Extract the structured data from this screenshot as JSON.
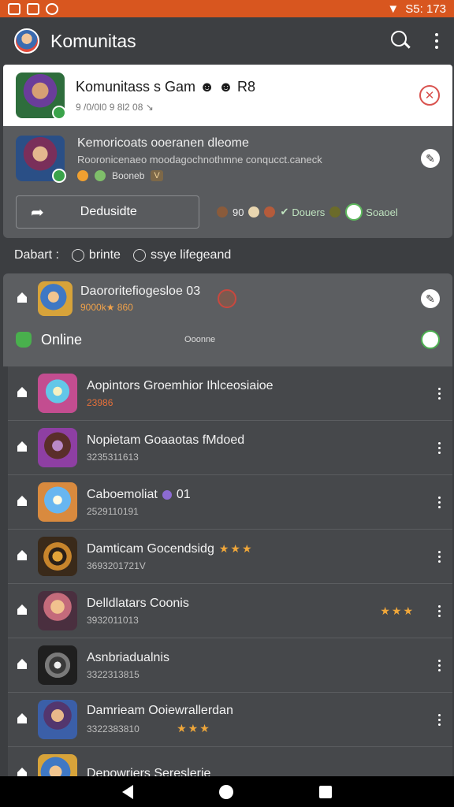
{
  "status_bar": {
    "right_text": "S5: 173"
  },
  "app_bar": {
    "title": "Komunitas"
  },
  "featured": {
    "title": "Komunitass s Gam",
    "emoji": "☻ ☻ R8",
    "meta": "9 /0/0l0 9 8l2 08 ↘"
  },
  "details": {
    "title": "Kemoricoats ooeranen dleome",
    "description": "Rooronicenaeo moodagochnothmne conqucct.caneck",
    "tag_label": "Booneb",
    "tag_box": "V",
    "share_label": "Dedusidte",
    "chip_count": "90",
    "chip_green_label": "Douers",
    "chip_pill_label": "Soaoel"
  },
  "filter": {
    "label": "Dabart :",
    "chip1": "brinte",
    "chip2": "ssye lifegeand"
  },
  "section": {
    "title": "Daororitefiogesloe 03",
    "subtitle": "9000k★ 860",
    "online_label": "Online",
    "online_count": "Ooonne"
  },
  "games": [
    {
      "title": "Aopintors Groemhior Ihlceosiaioe",
      "subtitle": "23986",
      "orange": true,
      "extra": "",
      "stars": ""
    },
    {
      "title": "Nopietam Goaaotas fMdoed",
      "subtitle": "3235311613",
      "orange": false,
      "extra": "",
      "stars": ""
    },
    {
      "title": "Caboemoliat",
      "subtitle": "2529110191",
      "orange": false,
      "extra": "01",
      "stars": ""
    },
    {
      "title": "Damticam Gocendsidg",
      "subtitle": "3693201721V",
      "orange": false,
      "extra": "",
      "stars": "★★★"
    },
    {
      "title": "Delldlatars Coonis",
      "subtitle": "3932011013",
      "orange": false,
      "extra": "",
      "stars": "★★★"
    },
    {
      "title": "Asnbriadualnis",
      "subtitle": "3322313815",
      "orange": false,
      "extra": "",
      "stars": ""
    },
    {
      "title": "Damrieam Ooiewrallerdan",
      "subtitle": "3322383810",
      "orange": false,
      "extra": "",
      "stars": "★★★"
    },
    {
      "title": "Depowriers Sereslerie",
      "subtitle": "",
      "orange": false,
      "extra": "",
      "stars": ""
    }
  ]
}
